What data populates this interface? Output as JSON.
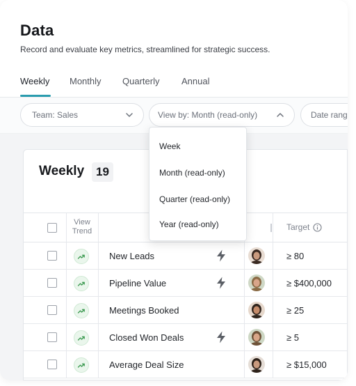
{
  "header": {
    "title": "Data",
    "subtitle": "Record and evaluate key metrics, streamlined for strategic success."
  },
  "tabs": [
    {
      "label": "Weekly",
      "active": true
    },
    {
      "label": "Monthly",
      "active": false
    },
    {
      "label": "Quarterly",
      "active": false
    },
    {
      "label": "Annual",
      "active": false
    }
  ],
  "filters": {
    "team": "Team: Sales",
    "view_by": "View by: Month (read-only)",
    "date_range": "Date rang"
  },
  "view_by_menu": {
    "options": [
      "Week",
      "Month (read-only)",
      "Quarter (read-only)",
      "Year (read-only)"
    ]
  },
  "table": {
    "title": "Weekly",
    "count": "19",
    "headers": {
      "view_trend": "View Trend",
      "target": "Target"
    },
    "rows": [
      {
        "metric": "New Leads",
        "automated": true,
        "avatar": "woman-dark-hair",
        "target": "≥ 80"
      },
      {
        "metric": "Pipeline Value",
        "automated": true,
        "avatar": "man-beard",
        "target": "≥ $400,000"
      },
      {
        "metric": "Meetings Booked",
        "automated": false,
        "avatar": "woman-curly",
        "target": "≥ 25"
      },
      {
        "metric": "Closed Won Deals",
        "automated": true,
        "avatar": "man-beard-2",
        "target": "≥ 5"
      },
      {
        "metric": "Average Deal Size",
        "automated": false,
        "avatar": "woman-dark-hair-2",
        "target": "≥ $15,000"
      }
    ]
  },
  "colors": {
    "accent": "#2a9cae",
    "trend_green": "#3d9a52",
    "bolt": "#5b5f66"
  }
}
